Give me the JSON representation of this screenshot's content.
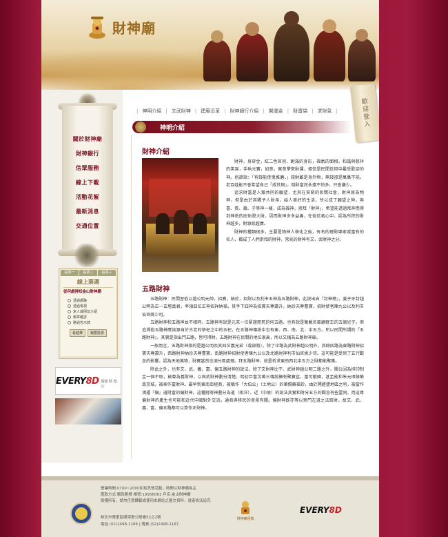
{
  "site": {
    "name": "財神廟"
  },
  "header": {
    "login_label": "歡迎登入"
  },
  "top_nav": {
    "items": [
      "神明介紹",
      "文武財神",
      "建廟沿革",
      "財神銀行介紹",
      "開運金",
      "財寶袋",
      "求財氣"
    ]
  },
  "left_menu": {
    "items": [
      "關於財神廟",
      "財神銀行",
      "信眾服務",
      "線上下載",
      "活動花絮",
      "最新消息",
      "交通位置"
    ]
  },
  "vote": {
    "tabs": [
      "投票一",
      "投票二",
      "投票三"
    ],
    "title": "線上票選",
    "question": "從何處得知金山財神廟",
    "options": [
      "透過網路",
      "透過電視",
      "家人或朋友介紹",
      "報章雜誌",
      "路過告示牌"
    ],
    "result_button": "看結果",
    "vote_button": "我要投票"
  },
  "ad": {
    "every_prefix": "EVERY",
    "every_suffix": "8D",
    "tagline": "經營.財.智.心"
  },
  "main": {
    "banner_title": "神明介紹",
    "section1_title": "財神介紹",
    "section1_paragraphs": [
      "財神，身穿金，紅二色官袍，飽滿的身形，福氣的面相，和諧與慈祥的笑容，手執元寶，如意，寓意帶來財運，相信是民間信仰中最受歡迎的神。俗諺說：「有錢能使鬼推磨。」錢財雖是身外物，無錢卻是萬萬不能。老百姓能不會希望自己「成世銅」，錢財當然永遠不怕多，只會嫌少。",
      "追求財富是人類共同的願望，尤其在貧窮的民間社會，財神原為物神，但是由於其賜予人財帛，給人美好的生活，所以成了願望之神，與喜、貴、壽、子等神一樣，成為福神。崇拜「財神」，希望能透過拜神而得到神祇的庇佑發大財，因而財神多多益善，在俗信者心中，認為所拜的財神越多，財源就越廣。",
      "財神的種類很多，主要是物神人格化之後，有名的理財專家或富有的名人，都成了人們崇拜的財神，常見的財神有文、武財神之分。"
    ],
    "section2_title": "五路財神",
    "section2_paragraphs": [
      "五路財神：民間習俗以趙公明元帥，招寶，納珍，招財以及利市五神為五路財神，此說出自『封神榜』，姜子牙封趙公明為正一玄壇真君，率領四位正神招祥納福，其手下四神為招寶天尊蕭升，納珍天尊曹寶，招財使者陳九公以及利市仙官姚少司。",
      "五路財神和五路神並不相同，五路神有說是元末一位緊誼而死的何五路，也有說是衛載名臣顧野王的五個兒子。但追溯俗五路神應該源自於古老的祭祀之中的五祀，在五路神傳說中也有東、西、南、北、中五方。所以民間所謂的『五路財神』，其實是指出門五路，皆可得財。五路財神在民間的地位很高，所以又稱為五路財神爺。",
      "一般而言，五路財神指的是趙公明及其四位義兄弟（或部將）。除了中路為武財神趙公明外，其餘四路為東路財神招寶天尊蕭升，西路財神納珍天尊曹寶，南路財神招財使者陳九公以及北路財神利市仙官姚少司。這可能是受到了五行觀念的影響，認為天地萬物，財寶當然也須分區處理。拜五路財神，就是祈求東南西北中五方之財都能聚集。",
      "除此之外，也有文、武、義、富、偏五路財神的說法。除了文財神比干、武財神趙公明二路之外，關公因為排印制金一個不取，被尊為義財神，以與武財神劃分清楚。明初巨富沈萬三傳說擁有聚寶盆，富可敵國，甚至能和朱元璋競築南京城，被奉作富財神。最早到東南亞經商，被稱作「大伯公」（土地公）的華僑蘇福珍，由於開疆墾地區之利，被當作鴻運『偏』道財富的偏財神。這種將財神劃分為道（南洋），近（中原）的說法其實和財分五方的觀念有些雷同。而這尊偏財神的產生也可能和近代中國對外交流，通商與移民的背景有關。偏財神既亦等以旁門左道之法取財，故文、武、義、富、偏五路都可以算作正財神。"
    ]
  },
  "footer": {
    "lines": [
      "營業時間:0700~2000如有其他活動，時間以財神廟為主",
      "匯款方式:郵政劃撥 帳號:19958061 戶名:金山財神廟",
      "版權所有，請勿任意轉載或使用本網站之圖文資料，違者依法追究",
      "",
      "新北市萬里區磺潭里公館崙52之2號",
      "電話 (02)2498-1186 | 傳真 (02)2498-1187"
    ],
    "temple_brand": "財神廟經典",
    "every_prefix": "EVERY",
    "every_suffix": "8D"
  },
  "colors": {
    "accent": "#7a1222",
    "background": "#8e0d2d",
    "gold": "#9a6a1e"
  }
}
